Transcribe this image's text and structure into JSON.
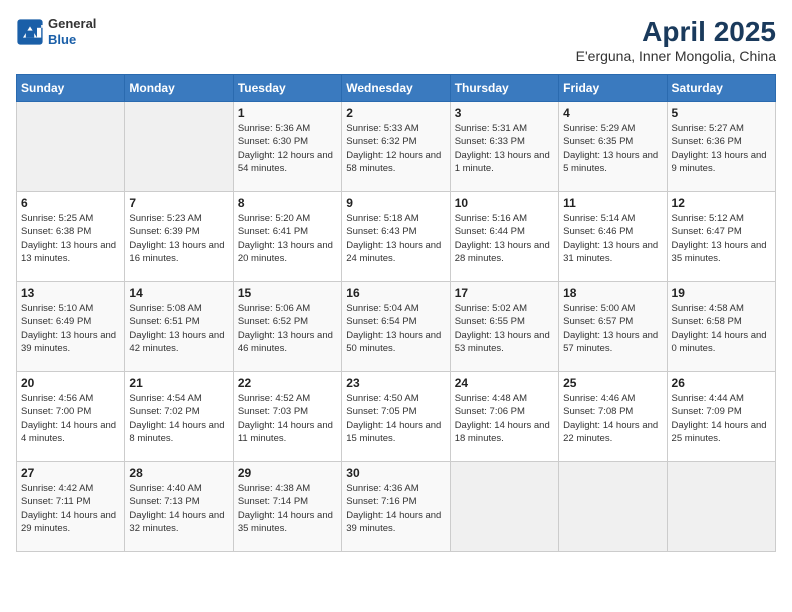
{
  "header": {
    "logo_general": "General",
    "logo_blue": "Blue",
    "title": "April 2025",
    "subtitle": "E'erguna, Inner Mongolia, China"
  },
  "weekdays": [
    "Sunday",
    "Monday",
    "Tuesday",
    "Wednesday",
    "Thursday",
    "Friday",
    "Saturday"
  ],
  "weeks": [
    [
      {
        "day": "",
        "sunrise": "",
        "sunset": "",
        "daylight": ""
      },
      {
        "day": "",
        "sunrise": "",
        "sunset": "",
        "daylight": ""
      },
      {
        "day": "1",
        "sunrise": "Sunrise: 5:36 AM",
        "sunset": "Sunset: 6:30 PM",
        "daylight": "Daylight: 12 hours and 54 minutes."
      },
      {
        "day": "2",
        "sunrise": "Sunrise: 5:33 AM",
        "sunset": "Sunset: 6:32 PM",
        "daylight": "Daylight: 12 hours and 58 minutes."
      },
      {
        "day": "3",
        "sunrise": "Sunrise: 5:31 AM",
        "sunset": "Sunset: 6:33 PM",
        "daylight": "Daylight: 13 hours and 1 minute."
      },
      {
        "day": "4",
        "sunrise": "Sunrise: 5:29 AM",
        "sunset": "Sunset: 6:35 PM",
        "daylight": "Daylight: 13 hours and 5 minutes."
      },
      {
        "day": "5",
        "sunrise": "Sunrise: 5:27 AM",
        "sunset": "Sunset: 6:36 PM",
        "daylight": "Daylight: 13 hours and 9 minutes."
      }
    ],
    [
      {
        "day": "6",
        "sunrise": "Sunrise: 5:25 AM",
        "sunset": "Sunset: 6:38 PM",
        "daylight": "Daylight: 13 hours and 13 minutes."
      },
      {
        "day": "7",
        "sunrise": "Sunrise: 5:23 AM",
        "sunset": "Sunset: 6:39 PM",
        "daylight": "Daylight: 13 hours and 16 minutes."
      },
      {
        "day": "8",
        "sunrise": "Sunrise: 5:20 AM",
        "sunset": "Sunset: 6:41 PM",
        "daylight": "Daylight: 13 hours and 20 minutes."
      },
      {
        "day": "9",
        "sunrise": "Sunrise: 5:18 AM",
        "sunset": "Sunset: 6:43 PM",
        "daylight": "Daylight: 13 hours and 24 minutes."
      },
      {
        "day": "10",
        "sunrise": "Sunrise: 5:16 AM",
        "sunset": "Sunset: 6:44 PM",
        "daylight": "Daylight: 13 hours and 28 minutes."
      },
      {
        "day": "11",
        "sunrise": "Sunrise: 5:14 AM",
        "sunset": "Sunset: 6:46 PM",
        "daylight": "Daylight: 13 hours and 31 minutes."
      },
      {
        "day": "12",
        "sunrise": "Sunrise: 5:12 AM",
        "sunset": "Sunset: 6:47 PM",
        "daylight": "Daylight: 13 hours and 35 minutes."
      }
    ],
    [
      {
        "day": "13",
        "sunrise": "Sunrise: 5:10 AM",
        "sunset": "Sunset: 6:49 PM",
        "daylight": "Daylight: 13 hours and 39 minutes."
      },
      {
        "day": "14",
        "sunrise": "Sunrise: 5:08 AM",
        "sunset": "Sunset: 6:51 PM",
        "daylight": "Daylight: 13 hours and 42 minutes."
      },
      {
        "day": "15",
        "sunrise": "Sunrise: 5:06 AM",
        "sunset": "Sunset: 6:52 PM",
        "daylight": "Daylight: 13 hours and 46 minutes."
      },
      {
        "day": "16",
        "sunrise": "Sunrise: 5:04 AM",
        "sunset": "Sunset: 6:54 PM",
        "daylight": "Daylight: 13 hours and 50 minutes."
      },
      {
        "day": "17",
        "sunrise": "Sunrise: 5:02 AM",
        "sunset": "Sunset: 6:55 PM",
        "daylight": "Daylight: 13 hours and 53 minutes."
      },
      {
        "day": "18",
        "sunrise": "Sunrise: 5:00 AM",
        "sunset": "Sunset: 6:57 PM",
        "daylight": "Daylight: 13 hours and 57 minutes."
      },
      {
        "day": "19",
        "sunrise": "Sunrise: 4:58 AM",
        "sunset": "Sunset: 6:58 PM",
        "daylight": "Daylight: 14 hours and 0 minutes."
      }
    ],
    [
      {
        "day": "20",
        "sunrise": "Sunrise: 4:56 AM",
        "sunset": "Sunset: 7:00 PM",
        "daylight": "Daylight: 14 hours and 4 minutes."
      },
      {
        "day": "21",
        "sunrise": "Sunrise: 4:54 AM",
        "sunset": "Sunset: 7:02 PM",
        "daylight": "Daylight: 14 hours and 8 minutes."
      },
      {
        "day": "22",
        "sunrise": "Sunrise: 4:52 AM",
        "sunset": "Sunset: 7:03 PM",
        "daylight": "Daylight: 14 hours and 11 minutes."
      },
      {
        "day": "23",
        "sunrise": "Sunrise: 4:50 AM",
        "sunset": "Sunset: 7:05 PM",
        "daylight": "Daylight: 14 hours and 15 minutes."
      },
      {
        "day": "24",
        "sunrise": "Sunrise: 4:48 AM",
        "sunset": "Sunset: 7:06 PM",
        "daylight": "Daylight: 14 hours and 18 minutes."
      },
      {
        "day": "25",
        "sunrise": "Sunrise: 4:46 AM",
        "sunset": "Sunset: 7:08 PM",
        "daylight": "Daylight: 14 hours and 22 minutes."
      },
      {
        "day": "26",
        "sunrise": "Sunrise: 4:44 AM",
        "sunset": "Sunset: 7:09 PM",
        "daylight": "Daylight: 14 hours and 25 minutes."
      }
    ],
    [
      {
        "day": "27",
        "sunrise": "Sunrise: 4:42 AM",
        "sunset": "Sunset: 7:11 PM",
        "daylight": "Daylight: 14 hours and 29 minutes."
      },
      {
        "day": "28",
        "sunrise": "Sunrise: 4:40 AM",
        "sunset": "Sunset: 7:13 PM",
        "daylight": "Daylight: 14 hours and 32 minutes."
      },
      {
        "day": "29",
        "sunrise": "Sunrise: 4:38 AM",
        "sunset": "Sunset: 7:14 PM",
        "daylight": "Daylight: 14 hours and 35 minutes."
      },
      {
        "day": "30",
        "sunrise": "Sunrise: 4:36 AM",
        "sunset": "Sunset: 7:16 PM",
        "daylight": "Daylight: 14 hours and 39 minutes."
      },
      {
        "day": "",
        "sunrise": "",
        "sunset": "",
        "daylight": ""
      },
      {
        "day": "",
        "sunrise": "",
        "sunset": "",
        "daylight": ""
      },
      {
        "day": "",
        "sunrise": "",
        "sunset": "",
        "daylight": ""
      }
    ]
  ]
}
